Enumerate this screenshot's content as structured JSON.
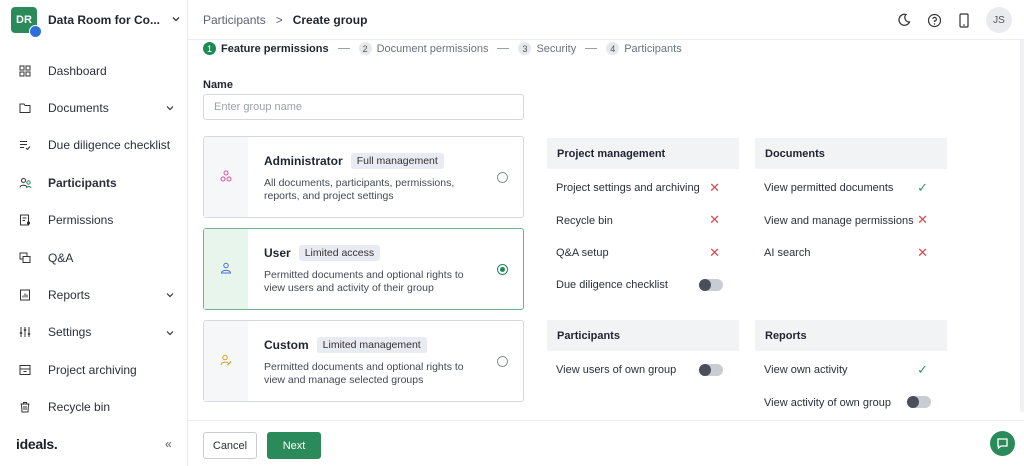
{
  "project": {
    "initials": "DR",
    "name": "Data Room for Co..."
  },
  "sidebar": {
    "items": [
      {
        "label": "Dashboard",
        "icon": "dashboard-icon"
      },
      {
        "label": "Documents",
        "icon": "documents-icon",
        "expandable": true
      },
      {
        "label": "Due diligence checklist",
        "icon": "checklist-icon"
      },
      {
        "label": "Participants",
        "icon": "participants-icon",
        "active": true
      },
      {
        "label": "Permissions",
        "icon": "permissions-icon"
      },
      {
        "label": "Q&A",
        "icon": "qa-icon"
      },
      {
        "label": "Reports",
        "icon": "reports-icon",
        "expandable": true
      },
      {
        "label": "Settings",
        "icon": "settings-icon",
        "expandable": true
      },
      {
        "label": "Project archiving",
        "icon": "archive-icon"
      },
      {
        "label": "Recycle bin",
        "icon": "trash-icon"
      }
    ],
    "brand": "ideals.",
    "collapse_label": "«"
  },
  "header": {
    "breadcrumb_parent": "Participants",
    "breadcrumb_sep": ">",
    "breadcrumb_current": "Create group",
    "user_initials": "JS"
  },
  "steps": [
    {
      "num": "1",
      "label": "Feature permissions",
      "current": true
    },
    {
      "num": "2",
      "label": "Document permissions"
    },
    {
      "num": "3",
      "label": "Security"
    },
    {
      "num": "4",
      "label": "Participants"
    }
  ],
  "form": {
    "name_label": "Name",
    "name_placeholder": "Enter group name",
    "name_value": ""
  },
  "roles": [
    {
      "title": "Administrator",
      "tag": "Full management",
      "desc": "All documents, participants, permissions, reports, and project settings",
      "selected": false,
      "icon_color": "#e0509a"
    },
    {
      "title": "User",
      "tag": "Limited access",
      "desc": "Permitted documents and optional rights to view users and activity of their group",
      "selected": true,
      "icon_color": "#4a6fd6"
    },
    {
      "title": "Custom",
      "tag": "Limited management",
      "desc": "Permitted documents and optional rights to view and manage selected groups",
      "selected": false,
      "icon_color": "#d9a21b"
    }
  ],
  "panels": {
    "project_management": {
      "title": "Project management",
      "rows": [
        {
          "label": "Project settings and archiving",
          "status": "cross"
        },
        {
          "label": "Recycle bin",
          "status": "cross"
        },
        {
          "label": "Q&A setup",
          "status": "cross"
        },
        {
          "label": "Due diligence checklist",
          "status": "toggle-off"
        }
      ]
    },
    "documents": {
      "title": "Documents",
      "rows": [
        {
          "label": "View permitted documents",
          "status": "check"
        },
        {
          "label": "View and manage permissions",
          "status": "cross"
        },
        {
          "label": "AI search",
          "status": "cross"
        }
      ]
    },
    "participants": {
      "title": "Participants",
      "rows": [
        {
          "label": "View users of own group",
          "status": "toggle-off"
        }
      ]
    },
    "reports": {
      "title": "Reports",
      "rows": [
        {
          "label": "View own activity",
          "status": "check"
        },
        {
          "label": "View activity of own group",
          "status": "toggle-off"
        }
      ]
    }
  },
  "footer": {
    "cancel_label": "Cancel",
    "next_label": "Next"
  },
  "colors": {
    "accent": "#2b8a5a",
    "cross": "#e0464d",
    "check": "#2b9a60"
  }
}
